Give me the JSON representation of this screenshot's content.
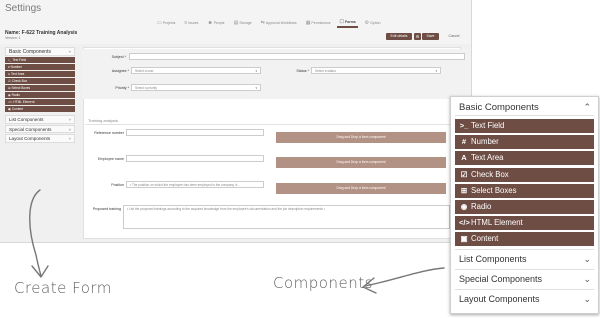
{
  "app": {
    "title": "Settings",
    "form_name": "Name: F-622 Training Analysis",
    "version": "Version: 1",
    "tabs": [
      {
        "label": "Projects",
        "icon": "folder-icon"
      },
      {
        "label": "Issues",
        "icon": "issues-icon"
      },
      {
        "label": "People",
        "icon": "people-icon"
      },
      {
        "label": "Storage",
        "icon": "storage-icon"
      },
      {
        "label": "Approval Workflows",
        "icon": "workflow-icon"
      },
      {
        "label": "Permissions",
        "icon": "permissions-icon"
      },
      {
        "label": "Forms",
        "icon": "forms-icon"
      },
      {
        "label": "Option",
        "icon": "option-icon"
      }
    ],
    "active_tab": "Forms",
    "buttons": {
      "edit": "Edit details",
      "save": "Save",
      "cancel": "Cancel"
    }
  },
  "mini_sidebar": {
    "header": "Basic Components",
    "items": [
      "Text Field",
      "Number",
      "Text Area",
      "Check Box",
      "Select Boxes",
      "Radio",
      "HTML Element",
      "Content"
    ],
    "accordions": [
      "List Components",
      "Special Components",
      "Layout Components"
    ]
  },
  "form": {
    "subject_label": "Subject *",
    "assignee_label": "Assignee *",
    "assignee_placeholder": "Select a user",
    "status_label": "Status *",
    "status_placeholder": "Select a status",
    "priority_label": "Priority *",
    "priority_placeholder": "Select a priority",
    "section_title": "Training analysis",
    "reference_label": "Reference number",
    "employee_label": "Employee name",
    "position_label": "Position",
    "position_placeholder": "• The position on which the employee has been employed in the company, fr...",
    "proposed_label": "Proposed training",
    "proposed_placeholder": "• List the proposed trainings according to the acquired knowledge from the employee's documentation and the job description requirements •",
    "drop_text": "Drag and Drop a form component"
  },
  "sidebar": {
    "header": "Basic Components",
    "items": [
      {
        "label": "Text Field",
        "icon": "text-field-icon",
        "glyph": ">_"
      },
      {
        "label": "Number",
        "icon": "hash-icon",
        "glyph": "#"
      },
      {
        "label": "Text Area",
        "icon": "font-icon",
        "glyph": "A"
      },
      {
        "label": "Check Box",
        "icon": "checkbox-icon",
        "glyph": "☑"
      },
      {
        "label": "Select Boxes",
        "icon": "plus-square-icon",
        "glyph": "⊞"
      },
      {
        "label": "Radio",
        "icon": "radio-icon",
        "glyph": "◉"
      },
      {
        "label": "HTML Element",
        "icon": "code-icon",
        "glyph": "</>"
      },
      {
        "label": "Content",
        "icon": "html5-icon",
        "glyph": "▣"
      }
    ],
    "accordions": [
      "List Components",
      "Special Components",
      "Layout Components"
    ]
  },
  "annotations": {
    "create_form": "Create Form",
    "components": "Components"
  },
  "colors": {
    "accent": "#6e4d44",
    "drop_zone": "#b39286"
  }
}
